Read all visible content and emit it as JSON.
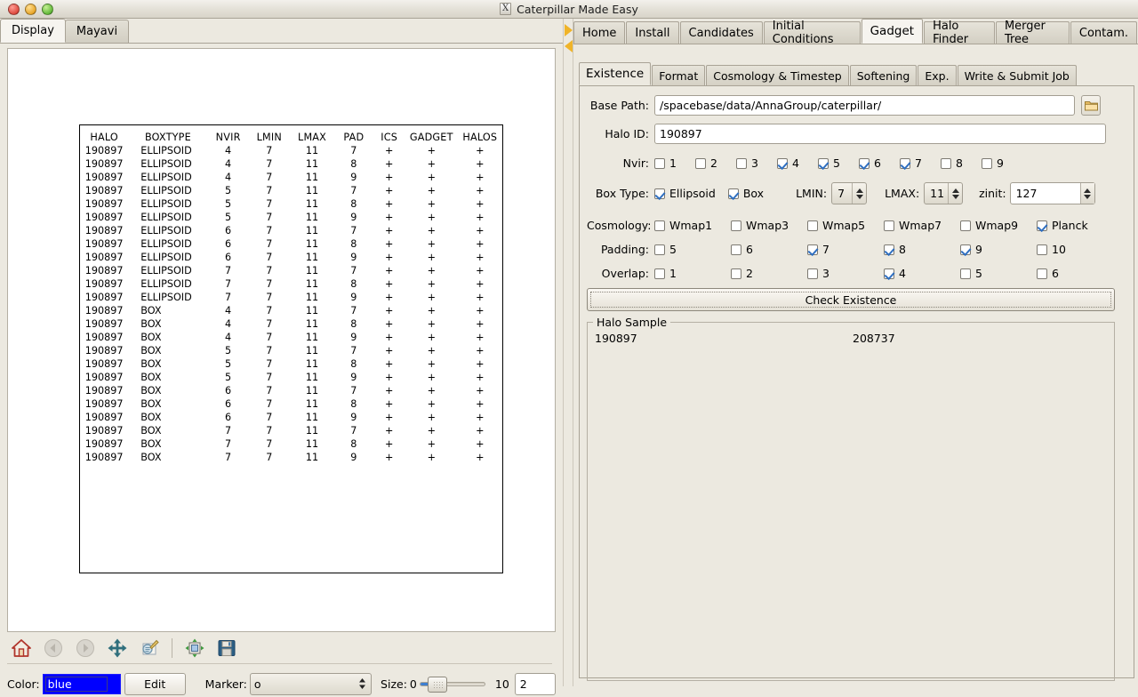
{
  "window": {
    "title": "Caterpillar Made Easy",
    "buttons": [
      "close",
      "minimize",
      "maximize"
    ]
  },
  "left_panel": {
    "tabs": [
      {
        "label": "Display",
        "active": true
      },
      {
        "label": "Mayavi",
        "active": false
      }
    ],
    "plot_table": {
      "headers": [
        "HALO",
        "BOXTYPE",
        "NVIR",
        "LMIN",
        "LMAX",
        "PAD",
        "ICS",
        "GADGET",
        "HALOS"
      ],
      "rows": [
        [
          "190897",
          "ELLIPSOID",
          "4",
          "7",
          "11",
          "7",
          "+",
          "+",
          "+"
        ],
        [
          "190897",
          "ELLIPSOID",
          "4",
          "7",
          "11",
          "8",
          "+",
          "+",
          "+"
        ],
        [
          "190897",
          "ELLIPSOID",
          "4",
          "7",
          "11",
          "9",
          "+",
          "+",
          "+"
        ],
        [
          "190897",
          "ELLIPSOID",
          "5",
          "7",
          "11",
          "7",
          "+",
          "+",
          "+"
        ],
        [
          "190897",
          "ELLIPSOID",
          "5",
          "7",
          "11",
          "8",
          "+",
          "+",
          "+"
        ],
        [
          "190897",
          "ELLIPSOID",
          "5",
          "7",
          "11",
          "9",
          "+",
          "+",
          "+"
        ],
        [
          "190897",
          "ELLIPSOID",
          "6",
          "7",
          "11",
          "7",
          "+",
          "+",
          "+"
        ],
        [
          "190897",
          "ELLIPSOID",
          "6",
          "7",
          "11",
          "8",
          "+",
          "+",
          "+"
        ],
        [
          "190897",
          "ELLIPSOID",
          "6",
          "7",
          "11",
          "9",
          "+",
          "+",
          "+"
        ],
        [
          "190897",
          "ELLIPSOID",
          "7",
          "7",
          "11",
          "7",
          "+",
          "+",
          "+"
        ],
        [
          "190897",
          "ELLIPSOID",
          "7",
          "7",
          "11",
          "8",
          "+",
          "+",
          "+"
        ],
        [
          "190897",
          "ELLIPSOID",
          "7",
          "7",
          "11",
          "9",
          "+",
          "+",
          "+"
        ],
        [
          "190897",
          "BOX",
          "4",
          "7",
          "11",
          "7",
          "+",
          "+",
          "+"
        ],
        [
          "190897",
          "BOX",
          "4",
          "7",
          "11",
          "8",
          "+",
          "+",
          "+"
        ],
        [
          "190897",
          "BOX",
          "4",
          "7",
          "11",
          "9",
          "+",
          "+",
          "+"
        ],
        [
          "190897",
          "BOX",
          "5",
          "7",
          "11",
          "7",
          "+",
          "+",
          "+"
        ],
        [
          "190897",
          "BOX",
          "5",
          "7",
          "11",
          "8",
          "+",
          "+",
          "+"
        ],
        [
          "190897",
          "BOX",
          "5",
          "7",
          "11",
          "9",
          "+",
          "+",
          "+"
        ],
        [
          "190897",
          "BOX",
          "6",
          "7",
          "11",
          "7",
          "+",
          "+",
          "+"
        ],
        [
          "190897",
          "BOX",
          "6",
          "7",
          "11",
          "8",
          "+",
          "+",
          "+"
        ],
        [
          "190897",
          "BOX",
          "6",
          "7",
          "11",
          "9",
          "+",
          "+",
          "+"
        ],
        [
          "190897",
          "BOX",
          "7",
          "7",
          "11",
          "7",
          "+",
          "+",
          "+"
        ],
        [
          "190897",
          "BOX",
          "7",
          "7",
          "11",
          "8",
          "+",
          "+",
          "+"
        ],
        [
          "190897",
          "BOX",
          "7",
          "7",
          "11",
          "9",
          "+",
          "+",
          "+"
        ]
      ]
    },
    "toolbar_icons": [
      "home-icon",
      "back-arrow-icon",
      "forward-arrow-icon",
      "pan-move-icon",
      "zoom-rect-icon",
      "configure-subplots-icon",
      "save-figure-icon"
    ],
    "controls": {
      "color_label": "Color:",
      "color_value": "blue",
      "color_hex": "#0000ff",
      "edit_label": "Edit",
      "marker_label": "Marker:",
      "marker_value": "o",
      "size_label": "Size:",
      "size_min": "0",
      "size_max": "10",
      "size_value": "2"
    }
  },
  "right_panel": {
    "main_tabs": [
      {
        "label": "Home",
        "active": false
      },
      {
        "label": "Install",
        "active": false
      },
      {
        "label": "Candidates",
        "active": false
      },
      {
        "label": "Initial Conditions",
        "active": false
      },
      {
        "label": "Gadget",
        "active": true
      },
      {
        "label": "Halo Finder",
        "active": false
      },
      {
        "label": "Merger Tree",
        "active": false
      },
      {
        "label": "Contam.",
        "active": false
      }
    ],
    "sub_tabs": [
      {
        "label": "Existence",
        "active": true
      },
      {
        "label": "Format",
        "active": false
      },
      {
        "label": "Cosmology & Timestep",
        "active": false
      },
      {
        "label": "Softening",
        "active": false
      },
      {
        "label": "Exp.",
        "active": false
      },
      {
        "label": "Write & Submit Job",
        "active": false
      }
    ],
    "form": {
      "base_path_label": "Base Path:",
      "base_path_value": "/spacebase/data/AnnaGroup/caterpillar/",
      "folder_icon": "folder-icon",
      "halo_id_label": "Halo ID:",
      "halo_id_value": "190897",
      "nvir_label": "Nvir:",
      "nvir_options": [
        {
          "label": "1",
          "checked": false
        },
        {
          "label": "2",
          "checked": false
        },
        {
          "label": "3",
          "checked": false
        },
        {
          "label": "4",
          "checked": true
        },
        {
          "label": "5",
          "checked": true
        },
        {
          "label": "6",
          "checked": true
        },
        {
          "label": "7",
          "checked": true
        },
        {
          "label": "8",
          "checked": false
        },
        {
          "label": "9",
          "checked": false
        }
      ],
      "box_type_label": "Box Type:",
      "box_type_options": [
        {
          "label": "Ellipsoid",
          "checked": true
        },
        {
          "label": "Box",
          "checked": true
        }
      ],
      "lmin_label": "LMIN:",
      "lmin_value": "7",
      "lmax_label": "LMAX:",
      "lmax_value": "11",
      "zinit_label": "zinit:",
      "zinit_value": "127",
      "cosmology_label": "Cosmology:",
      "cosmology_options": [
        {
          "label": "Wmap1",
          "checked": false
        },
        {
          "label": "Wmap3",
          "checked": false
        },
        {
          "label": "Wmap5",
          "checked": false
        },
        {
          "label": "Wmap7",
          "checked": false
        },
        {
          "label": "Wmap9",
          "checked": false
        },
        {
          "label": "Planck",
          "checked": true
        }
      ],
      "padding_label": "Padding:",
      "padding_options": [
        {
          "label": "5",
          "checked": false
        },
        {
          "label": "6",
          "checked": false
        },
        {
          "label": "7",
          "checked": true
        },
        {
          "label": "8",
          "checked": true
        },
        {
          "label": "9",
          "checked": true
        },
        {
          "label": "10",
          "checked": false
        }
      ],
      "overlap_label": "Overlap:",
      "overlap_options": [
        {
          "label": "1",
          "checked": false
        },
        {
          "label": "2",
          "checked": false
        },
        {
          "label": "3",
          "checked": false
        },
        {
          "label": "4",
          "checked": true
        },
        {
          "label": "5",
          "checked": false
        },
        {
          "label": "6",
          "checked": false
        }
      ],
      "check_existence_label": "Check Existence",
      "halo_sample_legend": "Halo Sample",
      "halo_sample_rows": [
        [
          "190897",
          "208737"
        ]
      ]
    }
  },
  "splitter": {
    "collapse_right_icon": "triangle-right-icon",
    "collapse_left_icon": "triangle-left-icon"
  }
}
